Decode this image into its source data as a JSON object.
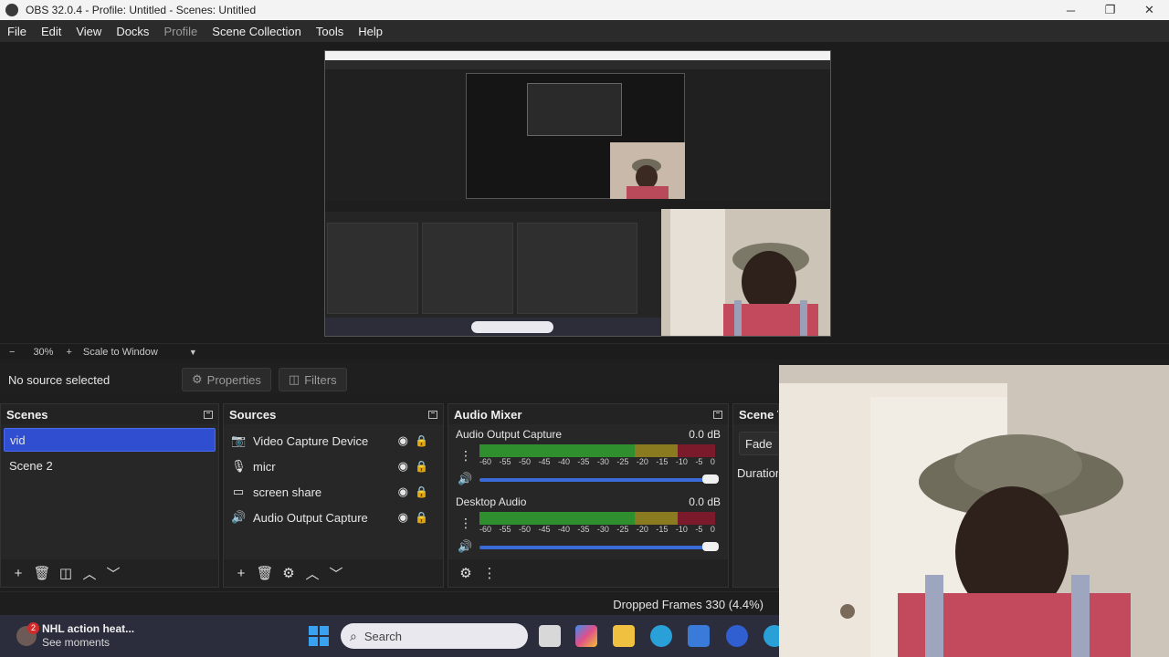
{
  "window": {
    "title": "OBS 32.0.4 - Profile: Untitled - Scenes: Untitled",
    "minimize": "─",
    "restore": "❐",
    "close": "✕"
  },
  "menu": [
    "File",
    "Edit",
    "View",
    "Docks",
    "Profile",
    "Scene Collection",
    "Tools",
    "Help"
  ],
  "preview_controls": {
    "zoom_out": "−",
    "zoom": "30%",
    "zoom_in": "+",
    "scale_mode": "Scale to Window",
    "dropdown": "▼"
  },
  "source_toolbar": {
    "status": "No source selected",
    "properties": "Properties",
    "filters": "Filters"
  },
  "scenes": {
    "title": "Scenes",
    "items": [
      "vid",
      "Scene 2"
    ],
    "selected": "vid"
  },
  "sources": {
    "title": "Sources",
    "items": [
      {
        "name": "Video Capture Device",
        "icon": "camera-icon"
      },
      {
        "name": "micr",
        "icon": "microphone-icon"
      },
      {
        "name": "screen share",
        "icon": "monitor-icon"
      },
      {
        "name": "Audio Output Capture",
        "icon": "speaker-icon"
      }
    ]
  },
  "audio_mixer": {
    "title": "Audio Mixer",
    "channels": [
      {
        "name": "Audio Output Capture",
        "level": "0.0 dB"
      },
      {
        "name": "Desktop Audio",
        "level": "0.0 dB"
      }
    ],
    "ticks": [
      "-60",
      "-55",
      "-50",
      "-45",
      "-40",
      "-35",
      "-30",
      "-25",
      "-20",
      "-15",
      "-10",
      "-5",
      "0"
    ]
  },
  "scene_transitions": {
    "title": "Scene T",
    "transition": "Fade",
    "duration_label": "Duration"
  },
  "status": {
    "dropped_frames": "Dropped Frames 330 (4.4%)"
  },
  "taskbar": {
    "news_badge": "2",
    "news_title": "NHL action heat...",
    "news_sub": "See moments",
    "search_label": "Search"
  },
  "colors": {
    "selection": "#2f4fd0",
    "meter_green": "#2f8f2f",
    "meter_yellow": "#8a7a20",
    "meter_red": "#7a1a2a",
    "fader_blue": "#3a6ad8"
  }
}
